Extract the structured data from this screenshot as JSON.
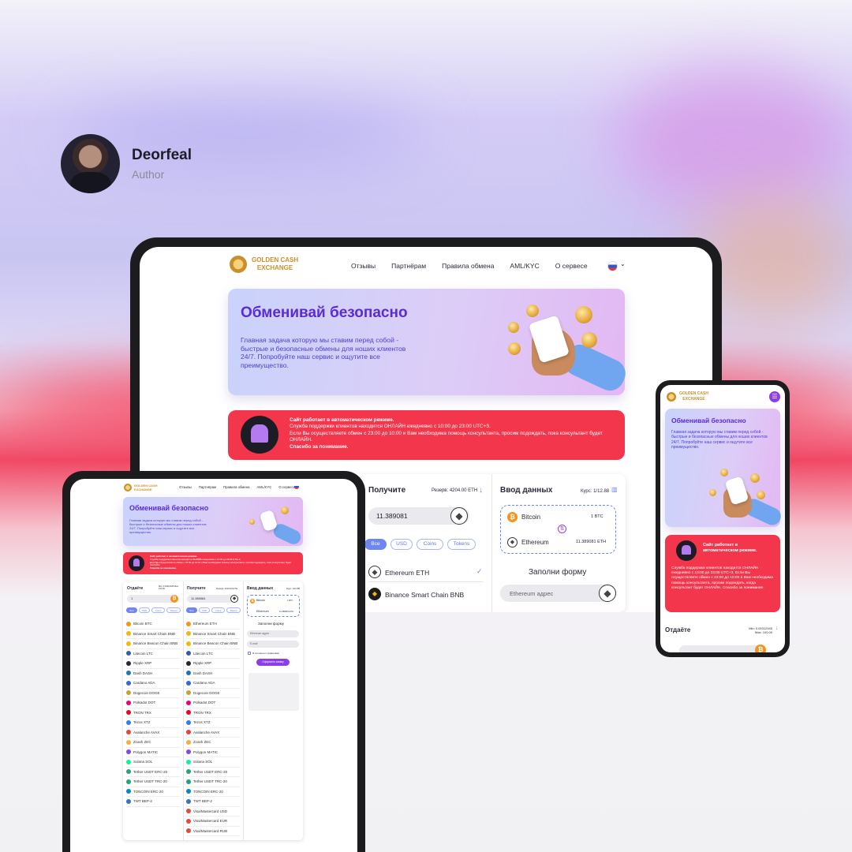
{
  "author": {
    "name": "Deorfeal",
    "role": "Author"
  },
  "brand": {
    "line1": "GOLDEN CASH",
    "line2": "EXCHANGE"
  },
  "nav": [
    "Отзывы",
    "Партнёрам",
    "Правила обмена",
    "AML/KYC",
    "О сервесе"
  ],
  "hero": {
    "title": "Обменивай безопасно",
    "text": "Главная задача которую мы ставим перед собой - быстрые и безопасные обмены для ноших клиентов 24/7. Попробуйте наш сервис и ощутите все преимущество."
  },
  "alert": {
    "title": "Сайт работает в автоматическом режиме.",
    "line1": "Служба поддержки клиентов находится ОНЛАЙН ежедневно с 10:00 до 23:00 UTC+3.",
    "line2": "Если Вы осуществляете обмен с 23:00 до 10:00 и Вам необходима помощь консультанта, просим подождать, пока консультант будет ОНЛАЙН.",
    "thanks": "Спасибо за понимание."
  },
  "receive": {
    "title": "Получите",
    "reserve": "Резерв: 4204.00 ETH",
    "amount": "11.389081",
    "filters": [
      "Все",
      "USD",
      "Coins",
      "Tokens"
    ],
    "items": [
      "Ethereum ETH",
      "Binance Smart Chain BNB"
    ]
  },
  "data_entry": {
    "title": "Ввод данных",
    "rate": "Курс: 1/12.88",
    "from_coin": "Bitcoin",
    "from_amount": "1 BTC",
    "to_coin": "Ethereum",
    "to_amount": "11.389081 ETH",
    "form_title": "Заполни форму",
    "address_placeholder": "Ethereum адрес"
  },
  "tablet": {
    "give_title": "Отдаёте",
    "give_limits": "Min: 0.00312945 Max: 100.00",
    "give_amount": "1",
    "receive_title": "Получите",
    "receive_reserve": "Резерв: 4204.00 ETH",
    "receive_amount": "11.389081",
    "entry_title": "Ввод данных",
    "entry_rate": "Курс: 1/12.88",
    "form_title": "Заполни форму",
    "address": "Ethereum адрес",
    "email": "E-mail",
    "agree": "Я согласен с правилами",
    "submit": "Оформить заявку",
    "left_list": [
      "Bitcoin BTC",
      "Binance Smart Chain BNB",
      "Binance Beacon Chain BNB",
      "Litecoin LTC",
      "Ripple XRP",
      "Dash DASH",
      "Cardano ADA",
      "Dogecoin DOGE",
      "Polkadot DOT",
      "TRON TRX",
      "Tezos XTZ",
      "Avalanche AVAX",
      "Zcash ZEC",
      "Polygon MATIC",
      "Solana SOL",
      "Tether USDT ERC-20",
      "Tether USDT TRC-20",
      "TONCOIN ERC-20",
      "TWT BEP-2"
    ],
    "right_list": [
      "Ethereum ETH",
      "Binance Smart Chain BNB",
      "Binance Beacon Chain BNB",
      "Litecoin LTC",
      "Ripple XRP",
      "Dash DASH",
      "Cardano ADA",
      "Dogecoin DOGE",
      "Polkadot DOT",
      "TRON TRX",
      "Tezos XTZ",
      "Avalanche AVAX",
      "Zcash ZEC",
      "Polygon MATIC",
      "Solana SOL",
      "Tether USDT ERC-20",
      "Tether USDT TRC-20",
      "TONCOIN ERC-20",
      "TWT BEP-2",
      "Visa/Mastercard USD",
      "Visa/Mastercard EUR",
      "Visa/Mastercard RUB"
    ]
  },
  "phone": {
    "alert_title": "Сайт работает в автоматическом режиме.",
    "alert_text": "Служба поддержки клиентов находится ОНЛАЙН ежедневно с 10:00 до 23:00 UTC+3. Если Вы осуществляете обмен с 23:00 до 10:00 и Вам необходима помощь консультанта, просим подождать, когда консультант будет ОНЛАЙН. Спасибо за понимание.",
    "give_title": "Отдаёте",
    "give_min": "Min: 0.00312945",
    "give_max": "Max: 100.00"
  },
  "colors": {
    "accent": "#5a2bd6",
    "alert": "#f4364c",
    "pill": "#6f86f2",
    "gold": "#c8902c"
  }
}
